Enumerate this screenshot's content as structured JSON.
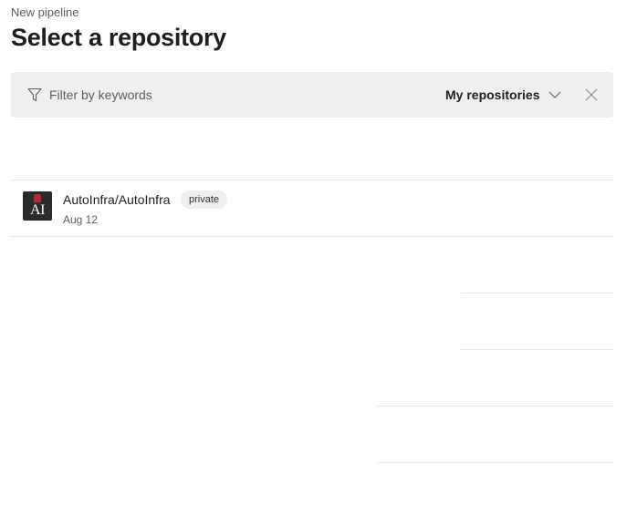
{
  "header": {
    "breadcrumb": "New pipeline",
    "title": "Select a repository"
  },
  "filter": {
    "placeholder": "Filter by keywords",
    "value": "",
    "scope_label": "My repositories",
    "icons": {
      "filter": "filter-icon",
      "scope": "chevron-down-icon",
      "clear": "close-icon"
    }
  },
  "repositories": [
    {
      "name": "AutoInfra/AutoInfra",
      "visibility": "private",
      "date": "Aug 12",
      "avatar_text": "AI"
    }
  ],
  "colors": {
    "filter_bar_bg": "#efefef",
    "badge_bg": "#efefef",
    "secondary_text": "#605e5c",
    "divider": "#e8e8e8"
  }
}
